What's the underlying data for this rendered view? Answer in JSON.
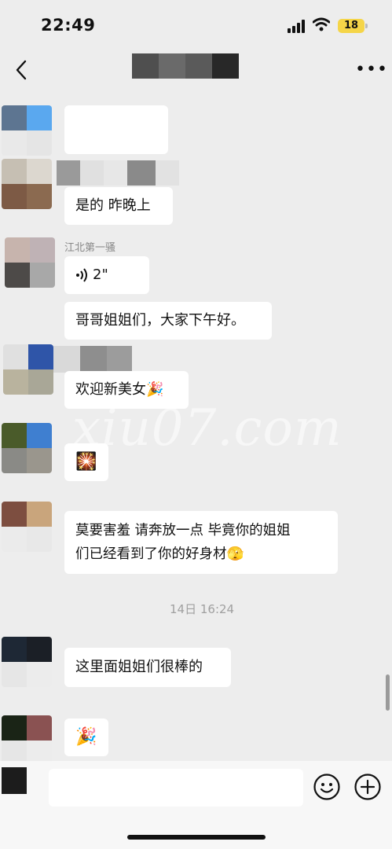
{
  "status_bar": {
    "time": "22:49",
    "battery": "18"
  },
  "header": {
    "back_icon": "chevron-left-icon",
    "more_icon": "more-dots-icon",
    "more_label": "•••"
  },
  "messages": [
    {
      "type": "text",
      "text": ""
    },
    {
      "type": "text",
      "text": "是的 昨晚上"
    },
    {
      "type": "voice",
      "nickname": "江北第一骚",
      "duration": "2\""
    },
    {
      "type": "text",
      "text": "哥哥姐姐们，大家下午好。"
    },
    {
      "type": "text",
      "text": "欢迎新美女🎉"
    },
    {
      "type": "emoji",
      "text": "🎇"
    },
    {
      "type": "text",
      "text_line1": "莫要害羞 请奔放一点 毕竟你的姐姐",
      "text_line2": "们已经看到了你的好身材🫣"
    },
    {
      "type": "timestamp",
      "text": "14日 16:24"
    },
    {
      "type": "text",
      "text": "这里面姐姐们很棒的"
    },
    {
      "type": "emoji",
      "text": "🎉"
    }
  ],
  "watermark": "xiu07.com",
  "input_bar": {
    "emoji_icon": "smile-icon",
    "plus_icon": "plus-circle-icon"
  }
}
